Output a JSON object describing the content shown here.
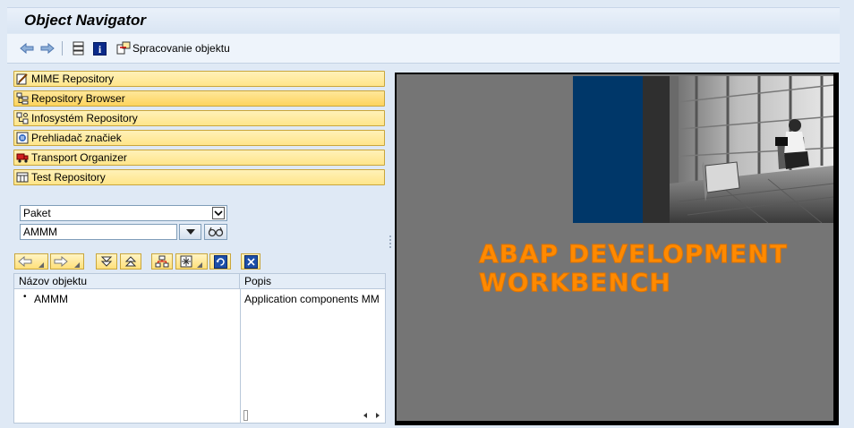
{
  "title": "Object Navigator",
  "toolbar": {
    "back_icon": "arrow-left-icon",
    "forward_icon": "arrow-right-icon",
    "display_icon": "hierarchy-icon",
    "info_icon": "info-icon",
    "object_processing_label": "Spracovanie objektu"
  },
  "nav": {
    "items": [
      {
        "label": "MIME Repository",
        "icon": "mime-icon"
      },
      {
        "label": "Repository Browser",
        "icon": "tree-icon"
      },
      {
        "label": "Infosystém Repository",
        "icon": "infosystem-icon"
      },
      {
        "label": "Prehliadač značiek",
        "icon": "tag-browser-icon"
      },
      {
        "label": "Transport Organizer",
        "icon": "truck-icon"
      },
      {
        "label": "Test Repository",
        "icon": "test-icon"
      }
    ],
    "active_index": 1
  },
  "selector": {
    "type_value": "Paket",
    "object_value": "AMMM"
  },
  "tree": {
    "columns": [
      "Názov objektu",
      "Popis"
    ],
    "rows": [
      {
        "name": "AMMM",
        "description": "Application components MM"
      }
    ]
  },
  "banner": {
    "line1": "ABAP DEVELOPMENT",
    "line2": "WORKBENCH"
  },
  "colors": {
    "accent_yellow": "#ffe58a",
    "banner_blue": "#003769",
    "banner_gray": "#757575",
    "banner_text": "#ff8a00"
  }
}
